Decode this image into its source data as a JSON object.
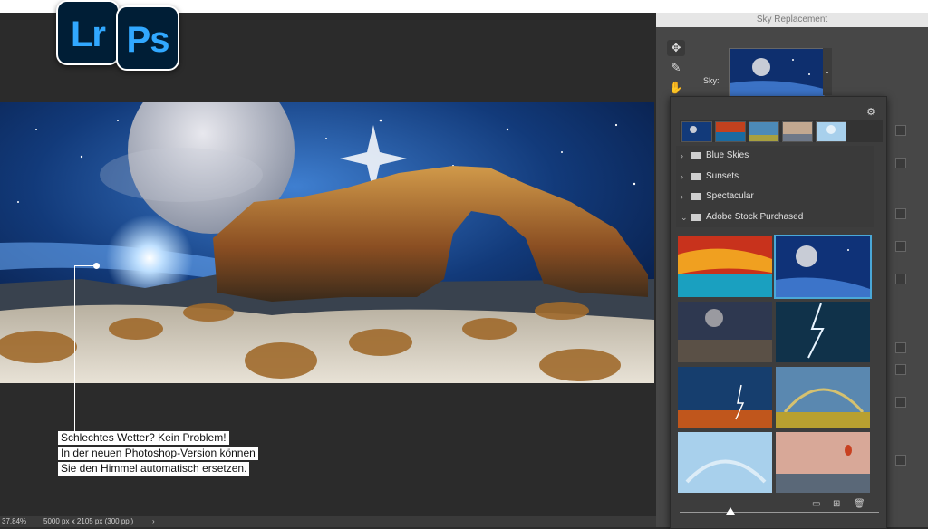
{
  "apps": {
    "lightroom": "Lr",
    "photoshop": "Ps"
  },
  "caption": {
    "line1": "Schlechtes Wetter? Kein Problem!",
    "line2": "In der neuen Photoshop-Version können",
    "line3": "Sie den Himmel automatisch ersetzen."
  },
  "status": {
    "zoom": "37.84%",
    "doc_info": "5000 px x 2105 px (300 ppi)",
    "arrow": "›"
  },
  "panel": {
    "title": "Sky Replacement",
    "sky_label": "Sky:",
    "folders": [
      {
        "label": "Blue Skies",
        "expanded": false
      },
      {
        "label": "Sunsets",
        "expanded": false
      },
      {
        "label": "Spectacular",
        "expanded": false
      },
      {
        "label": "Adobe Stock Purchased",
        "expanded": true
      }
    ],
    "icons": {
      "move": "move-icon",
      "brush": "brush-icon",
      "hand": "hand-icon",
      "gear": "gear-icon",
      "folder": "folder-icon",
      "new": "new-icon",
      "trash": "trash-icon"
    },
    "thumb_size": 0.07
  },
  "colors": {
    "accent": "#4aa8d8",
    "panel_bg": "#474747",
    "app_bg": "#001e36",
    "app_fg": "#31a8ff"
  }
}
